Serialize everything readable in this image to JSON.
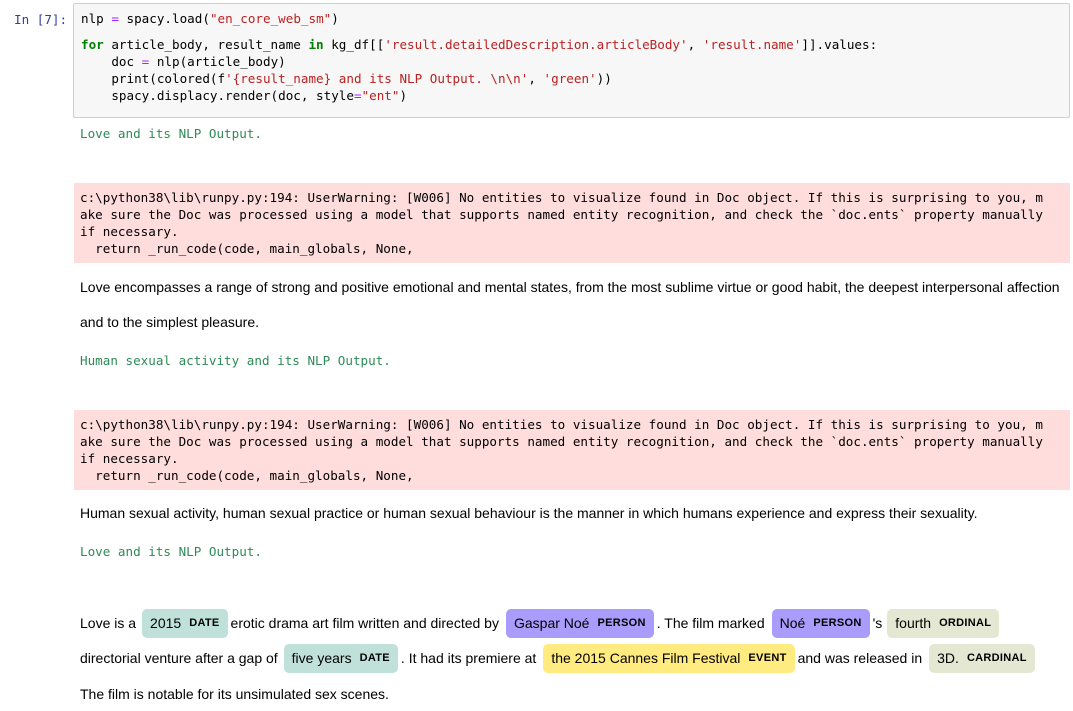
{
  "cell": {
    "prompt": "In [7]:",
    "code": {
      "line1": [
        "nlp ",
        "=",
        " spacy.load(",
        "\"en_core_web_sm\"",
        ")"
      ],
      "line2": [
        "for",
        " article_body, result_name ",
        "in",
        " kg_df[[",
        "'result.detailedDescription.articleBody'",
        ", ",
        "'result.name'",
        "]].values:"
      ],
      "line3": [
        "    doc ",
        "=",
        " nlp(article_body)"
      ],
      "line4": [
        "    print(colored(f",
        "'{result_name} and its NLP Output. \\n\\n'",
        ", ",
        "'green'",
        "))"
      ],
      "line5": [
        "    spacy.displacy.render(doc, style",
        "=",
        "\"ent\"",
        ")"
      ]
    }
  },
  "outputs": {
    "heading1": "Love and its NLP Output.",
    "warning1": [
      "c:\\python38\\lib\\runpy.py:194: UserWarning: [W006] No entities to visualize found in Doc object. If this is surprising to you, m",
      "ake sure the Doc was processed using a model that supports named entity recognition, and check the `doc.ents` property manually",
      "if necessary.",
      "  return _run_code(code, main_globals, None,"
    ],
    "para1_line1": "Love encompasses a range of strong and positive emotional and mental states, from the most sublime virtue or good habit, the deepest interpersonal affection",
    "para1_line2": "and to the simplest pleasure.",
    "heading2": "Human sexual activity and its NLP Output.",
    "warning2": [
      "c:\\python38\\lib\\runpy.py:194: UserWarning: [W006] No entities to visualize found in Doc object. If this is surprising to you, m",
      "ake sure the Doc was processed using a model that supports named entity recognition, and check the `doc.ents` property manually",
      "if necessary.",
      "  return _run_code(code, main_globals, None,"
    ],
    "para2": "Human sexual activity, human sexual practice or human sexual behaviour is the manner in which humans experience and express their sexuality.",
    "heading3": "Love and its NLP Output.",
    "ent_line1": {
      "t1": "Love is a",
      "e1": {
        "text": "2015",
        "label": "DATE"
      },
      "t2": "erotic drama art film written and directed by",
      "e2": {
        "text": "Gaspar Noé",
        "label": "PERSON"
      },
      "t3": ". The film marked",
      "e3": {
        "text": "Noé",
        "label": "PERSON"
      },
      "t4": "'s",
      "e4": {
        "text": "fourth",
        "label": "ORDINAL"
      }
    },
    "ent_line2": {
      "t1": "directorial venture after a gap of",
      "e1": {
        "text": "five years",
        "label": "DATE"
      },
      "t2": ". It had its premiere at",
      "e2": {
        "text": "the 2015 Cannes Film Festival",
        "label": "EVENT"
      },
      "t3": "and was released in",
      "e3": {
        "text": "3D.",
        "label": "CARDINAL"
      }
    },
    "ent_line3": "The film is notable for its unsimulated sex scenes."
  },
  "colors": {
    "DATE": "#bfe1d9",
    "PERSON": "#aa9cfc",
    "ORDINAL": "#e4e7d2",
    "EVENT": "#ffeb80",
    "CARDINAL": "#e4e7d2",
    "stderr_bg": "#ffdddd",
    "green_text": "#2e8b57"
  }
}
